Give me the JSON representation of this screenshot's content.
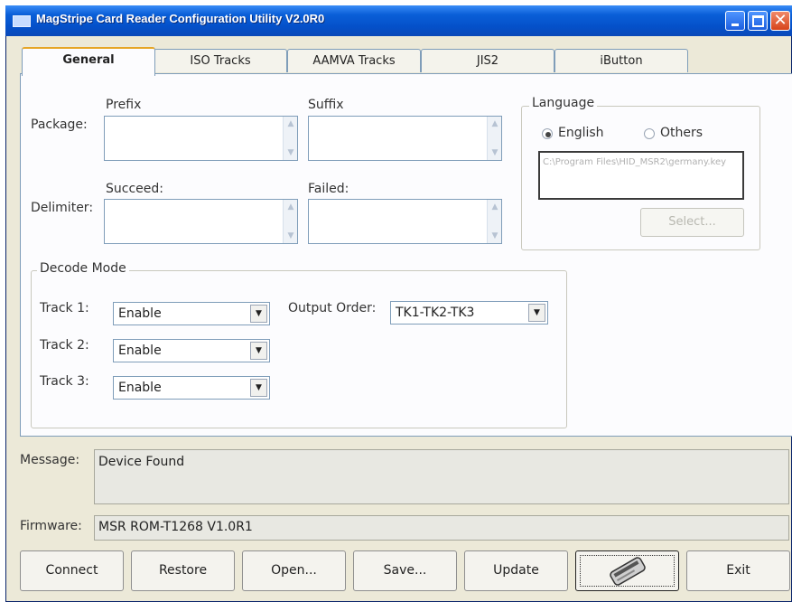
{
  "window": {
    "title": "MagStripe Card Reader Configuration Utility V2.0R0",
    "minimize": "",
    "maximize": "",
    "close": "✕"
  },
  "tabs": [
    "General",
    "ISO Tracks",
    "AAMVA Tracks",
    "JIS2",
    "iButton"
  ],
  "general": {
    "package_label": "Package:",
    "prefix_label": "Prefix",
    "suffix_label": "Suffix",
    "prefix_value": "",
    "suffix_value": "",
    "delimiter_label": "Delimiter:",
    "succeed_label": "Succeed:",
    "failed_label": "Failed:",
    "succeed_value": "",
    "failed_value": "",
    "language": {
      "legend": "Language",
      "english": "English",
      "others": "Others",
      "selected": "English",
      "file_path": "C:\\Program Files\\HID_MSR2\\germany.key",
      "select_button": "Select..."
    },
    "decode_mode": {
      "legend": "Decode Mode",
      "track1_label": "Track 1:",
      "track1_value": "Enable",
      "track2_label": "Track 2:",
      "track2_value": "Enable",
      "track3_label": "Track 3:",
      "track3_value": "Enable",
      "output_order_label": "Output Order:",
      "output_order_value": "TK1-TK2-TK3"
    }
  },
  "status": {
    "message_label": "Message:",
    "message_value": "Device Found",
    "firmware_label": "Firmware:",
    "firmware_value": "MSR ROM-T1268 V1.0R1"
  },
  "buttons": {
    "connect": "Connect",
    "restore": "Restore",
    "open": "Open...",
    "save": "Save...",
    "update": "Update",
    "swipe_icon": "card-swipe-icon",
    "exit": "Exit"
  }
}
